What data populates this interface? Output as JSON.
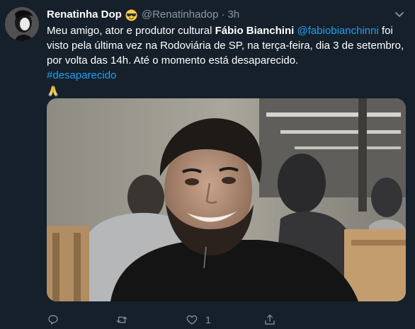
{
  "tweet": {
    "display_name": "Renatinha Dop",
    "handle": "@Renatinhadop",
    "separator": "·",
    "time": "3h",
    "text": {
      "part1": "Meu amigo, ator e produtor cultural ",
      "bold_name": "Fábio Bianchini",
      "space": " ",
      "mention": "@fabiobianchinni",
      "part2": " foi visto pela última vez na Rodoviária de SP, na terça-feira, dia 3 de setembro, por volta das 14h. Até o momento está desaparecido.",
      "hashtag": "#desaparecido"
    },
    "actions": {
      "like_count": "1"
    }
  },
  "icons": {
    "header_emoji": "sunglasses-emoji-icon",
    "text_emoji": "folded-hands-emoji-icon",
    "caret": "chevron-down-icon",
    "reply": "reply-icon",
    "retweet": "retweet-icon",
    "like": "heart-icon",
    "share": "share-icon"
  },
  "colors": {
    "background": "#15202b",
    "text": "#ffffff",
    "secondary": "#8899a6",
    "link": "#1da1f2"
  }
}
